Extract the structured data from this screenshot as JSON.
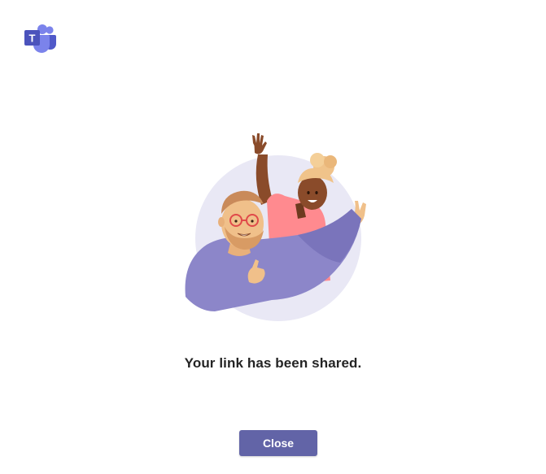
{
  "app": {
    "logo_icon": "microsoft-teams-logo-icon",
    "logo_letter": "T"
  },
  "illustration": {
    "icon": "people-waving-illustration"
  },
  "message": {
    "text": "Your link has been shared."
  },
  "actions": {
    "close_label": "Close"
  },
  "colors": {
    "accent": "#6264a7",
    "text": "#242424",
    "background": "#ffffff"
  }
}
